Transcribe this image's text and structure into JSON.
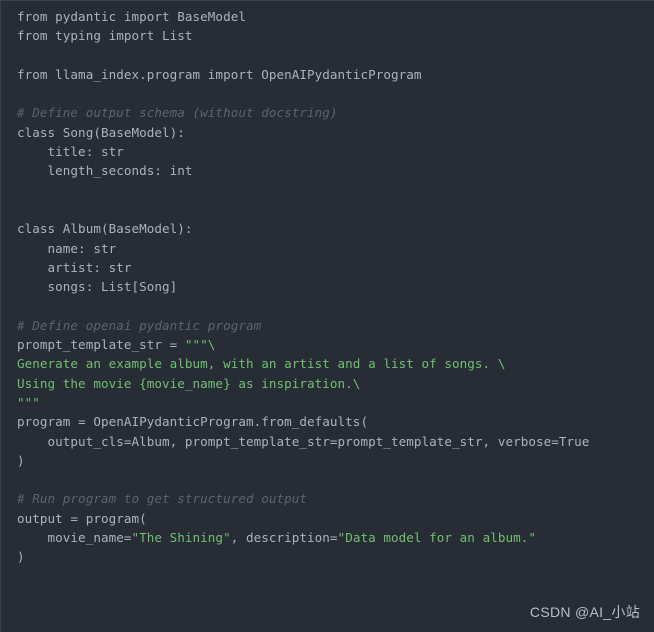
{
  "editor": {
    "language": "python",
    "theme": "one-dark",
    "background_color": "#282c34",
    "default_text_color": "#abb2bf",
    "comment_color": "#5c6370",
    "string_color": "#6fbf73",
    "lines": [
      {
        "type": "code",
        "text": "from pydantic import BaseModel"
      },
      {
        "type": "code",
        "text": "from typing import List"
      },
      {
        "type": "blank",
        "text": ""
      },
      {
        "type": "code",
        "text": "from llama_index.program import OpenAIPydanticProgram"
      },
      {
        "type": "blank",
        "text": ""
      },
      {
        "type": "comment",
        "text": "# Define output schema (without docstring)"
      },
      {
        "type": "code",
        "text": "class Song(BaseModel):"
      },
      {
        "type": "code",
        "text": "    title: str"
      },
      {
        "type": "code",
        "text": "    length_seconds: int"
      },
      {
        "type": "blank",
        "text": ""
      },
      {
        "type": "blank",
        "text": ""
      },
      {
        "type": "code",
        "text": "class Album(BaseModel):"
      },
      {
        "type": "code",
        "text": "    name: str"
      },
      {
        "type": "code",
        "text": "    artist: str"
      },
      {
        "type": "code",
        "text": "    songs: List[Song]"
      },
      {
        "type": "blank",
        "text": ""
      },
      {
        "type": "comment",
        "text": "# Define openai pydantic program"
      },
      {
        "type": "mixed",
        "text": "prompt_template_str = \"\"\"\\",
        "plain": "prompt_template_str = ",
        "string": "\"\"\"\\"
      },
      {
        "type": "string",
        "text": "Generate an example album, with an artist and a list of songs. \\"
      },
      {
        "type": "string",
        "text": "Using the movie {movie_name} as inspiration.\\"
      },
      {
        "type": "string",
        "text": "\"\"\""
      },
      {
        "type": "code",
        "text": "program = OpenAIPydanticProgram.from_defaults("
      },
      {
        "type": "code",
        "text": "    output_cls=Album, prompt_template_str=prompt_template_str, verbose=True"
      },
      {
        "type": "code",
        "text": ")"
      },
      {
        "type": "blank",
        "text": ""
      },
      {
        "type": "comment",
        "text": "# Run program to get structured output"
      },
      {
        "type": "code",
        "text": "output = program("
      },
      {
        "type": "mixed3",
        "text": "    movie_name=\"The Shining\", description=\"Data model for an album.\"",
        "p1": "    movie_name=",
        "s1": "\"The Shining\"",
        "p2": ", description=",
        "s2": "\"Data model for an album.\""
      },
      {
        "type": "code",
        "text": ")"
      }
    ]
  },
  "watermark": {
    "text": "CSDN @AI_小站"
  }
}
